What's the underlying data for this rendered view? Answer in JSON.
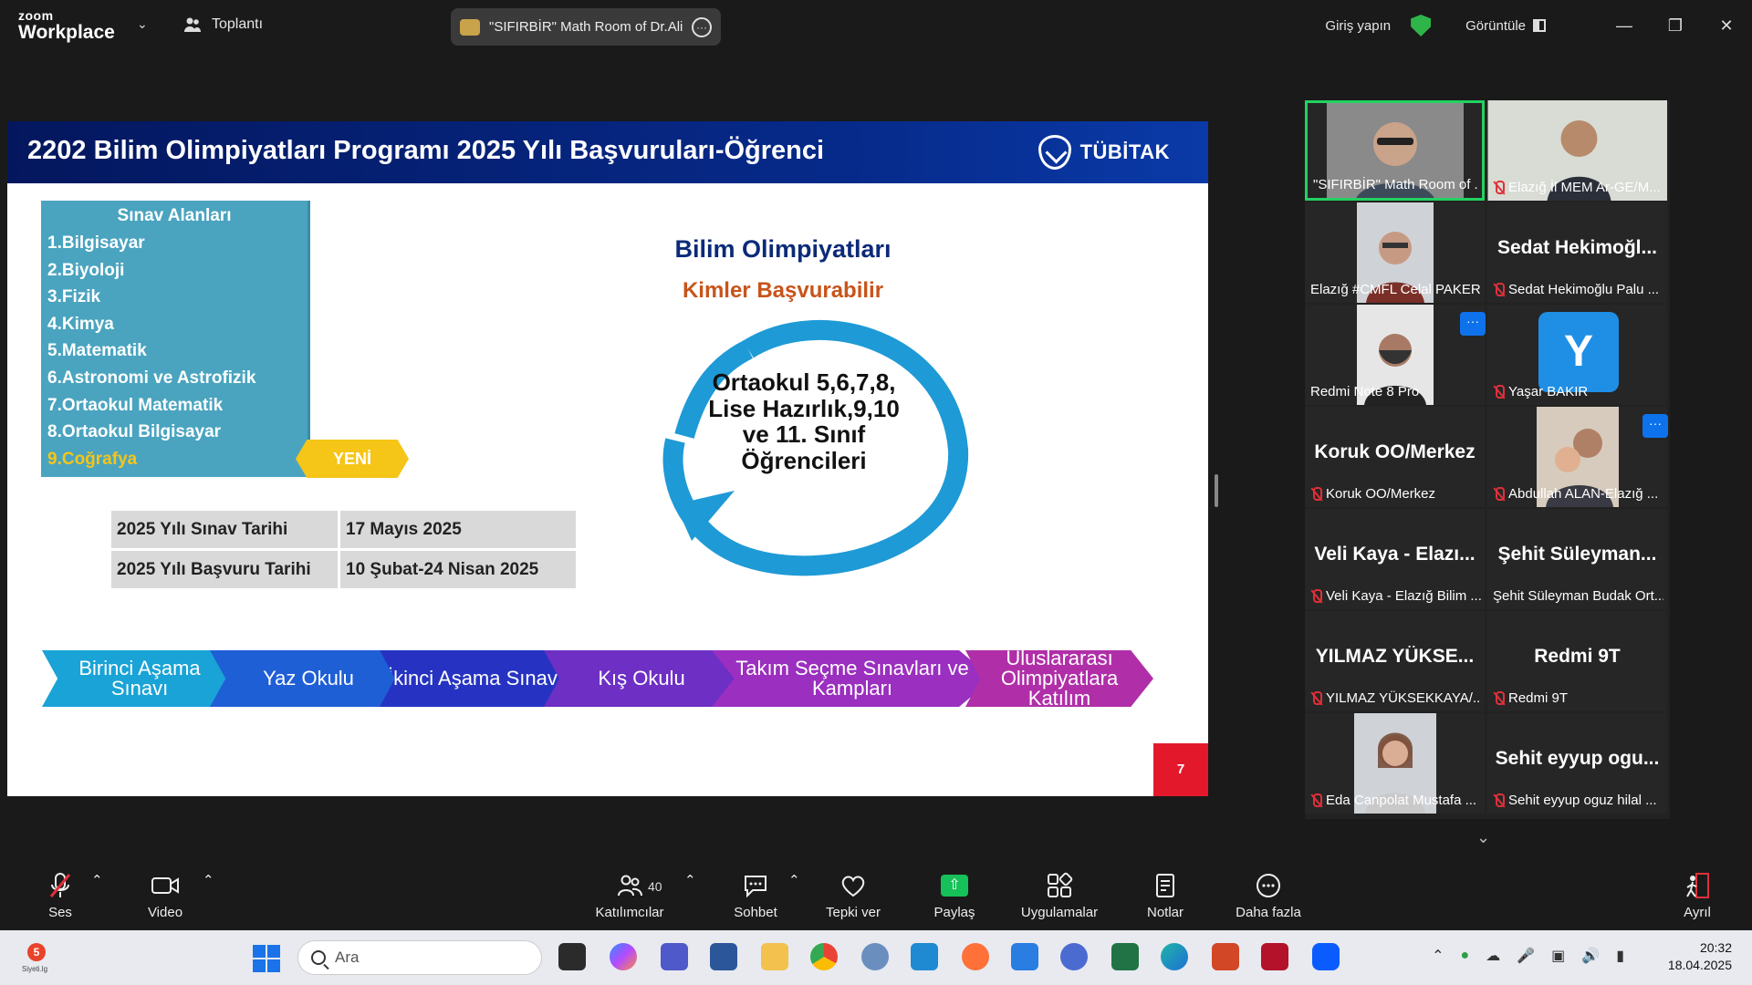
{
  "window": {
    "app_logo_line1": "zoom",
    "app_logo_line2": "Workplace",
    "meeting_menu_label": "Toplantı",
    "meeting_name": "\"SIFIRBİR\" Math Room of Dr.Ali İ",
    "login_label": "Giriş yapın",
    "view_label": "Görüntüle",
    "controls": [
      "minimize",
      "restore",
      "close"
    ]
  },
  "slide": {
    "title": "2202 Bilim Olimpiyatları Programı 2025 Yılı Başvuruları-Öğrenci",
    "brand": "TÜBİTAK",
    "areas_heading": "Sınav Alanları",
    "areas": [
      "1.Bilgisayar",
      "2.Biyoloji",
      "3.Fizik",
      "4.Kimya",
      "5.Matematik",
      "6.Astronomi ve Astrofizik",
      "7.Ortaokul Matematik",
      "8.Ortaokul Bilgisayar",
      "9.Coğrafya"
    ],
    "new_badge": "YENİ",
    "dates": [
      {
        "label": "2025 Yılı Sınav Tarihi",
        "value": "17 Mayıs 2025"
      },
      {
        "label": "2025 Yılı Başvuru Tarihi",
        "value": "10 Şubat-24 Nisan 2025"
      }
    ],
    "olympiad_title": "Bilim Olimpiyatları",
    "olympiad_subtitle": "Kimler Başvurabilir",
    "eligibility": "Ortaokul 5,6,7,8, Lise Hazırlık,9,10 ve 11. Sınıf Öğrencileri",
    "steps": [
      {
        "label": "Birinci Aşama Sınavı",
        "color": "#1aa3d6"
      },
      {
        "label": "Yaz Okulu",
        "color": "#1f5fd6"
      },
      {
        "label": "İkinci Aşama Sınavı",
        "color": "#2633c2"
      },
      {
        "label": "Kış Okulu",
        "color": "#6d2fc4"
      },
      {
        "label": "Takım Seçme Sınavları ve Kampları",
        "color": "#9b2fbf"
      },
      {
        "label": "Uluslararası Olimpiyatlara Katılım",
        "color": "#b02fa8"
      }
    ],
    "page_number": "7",
    "colors": {
      "header": "#04175e",
      "areas_box": "#4aa4bf",
      "new_item": "#f5c518",
      "cycle": "#1e9ad6",
      "subtitle": "#c8541a",
      "page_badge": "#e3192b"
    }
  },
  "participants": {
    "tiles": [
      {
        "label": "\"SIFIRBİR\" Math Room of ...",
        "muted": false,
        "video": true,
        "active": true
      },
      {
        "label": "Elazığ İl MEM Ar-GE/M...",
        "muted": true,
        "video": true
      },
      {
        "label": "Elazığ #CMFL Celal PAKER",
        "muted": false,
        "video": true
      },
      {
        "big_name": "Sedat Hekimoğl...",
        "label": "Sedat Hekimoğlu Palu ...",
        "muted": true
      },
      {
        "label": "Redmi Note 8 Pro",
        "muted": false,
        "video": true
      },
      {
        "avatar_letter": "Y",
        "label": "Yaşar BAKIR",
        "muted": true
      },
      {
        "big_name": "Koruk OO/Merkez",
        "label": "Koruk OO/Merkez",
        "muted": true
      },
      {
        "label": "Abdullah ALAN-Elazığ ...",
        "muted": true,
        "video": true
      },
      {
        "big_name": "Veli Kaya - Elazı...",
        "label": "Veli Kaya - Elazığ Bilim ...",
        "muted": true
      },
      {
        "big_name": "Şehit Süleyman...",
        "label": "Şehit Süleyman Budak Ort...",
        "muted": false
      },
      {
        "big_name": "YILMAZ YÜKSE...",
        "label": "YILMAZ YÜKSEKKAYA/...",
        "muted": true
      },
      {
        "big_name": "Redmi 9T",
        "label": "Redmi 9T",
        "muted": true
      },
      {
        "label": "Eda Canpolat  Mustafa ...",
        "muted": true,
        "video": true
      },
      {
        "big_name": "Sehit eyyup ogu...",
        "label": "Sehit eyyup oguz hilal ...",
        "muted": true
      }
    ],
    "more_button": "···"
  },
  "toolbar": {
    "audio": "Ses",
    "video": "Video",
    "participants": "Katılımcılar",
    "participants_count": "40",
    "chat": "Sohbet",
    "react": "Tepki ver",
    "share": "Paylaş",
    "apps": "Uygulamalar",
    "notes": "Notlar",
    "more": "Daha fazla",
    "leave": "Ayrıl"
  },
  "taskbar": {
    "search_placeholder": "Ara",
    "weather_badge": "5",
    "weather_label": "Siyeti.lg",
    "time": "20:32",
    "date": "18.04.2025"
  }
}
